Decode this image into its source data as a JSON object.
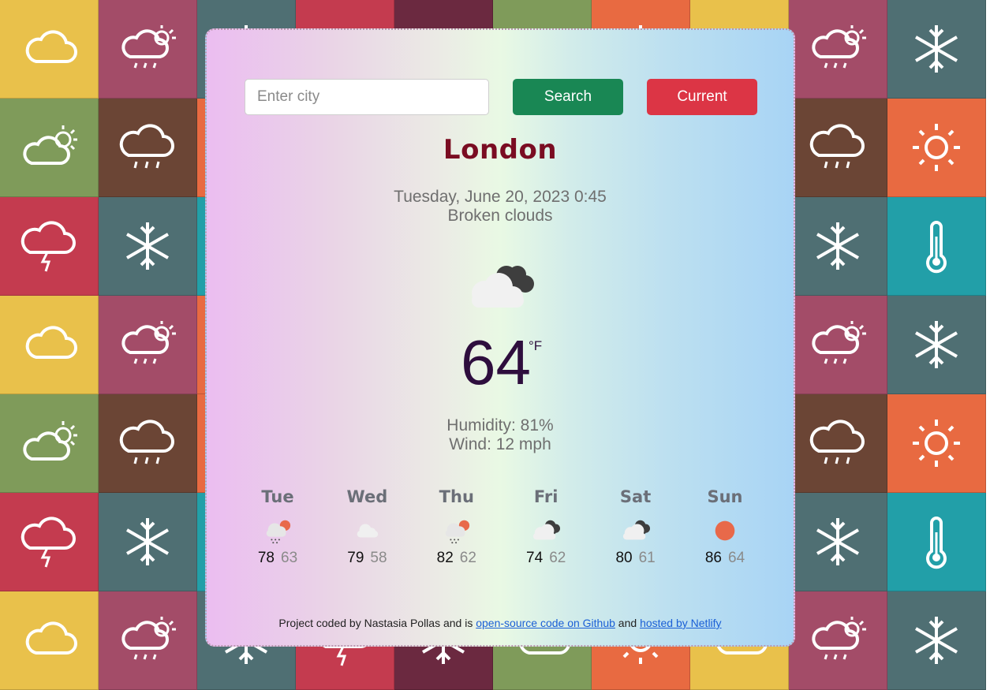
{
  "search": {
    "placeholder": "Enter city",
    "search_label": "Search",
    "current_label": "Current"
  },
  "weather": {
    "city": "London",
    "date": "Tuesday, June 20, 2023 0:45",
    "description": "Broken clouds",
    "icon": "broken-clouds-icon",
    "temperature": "64",
    "unit": "°F",
    "humidity": "Humidity: 81%",
    "wind": "Wind: 12 mph"
  },
  "forecast": [
    {
      "day": "Tue",
      "icon": "rain-icon",
      "max": "78",
      "min": "63"
    },
    {
      "day": "Wed",
      "icon": "few-clouds-icon",
      "max": "79",
      "min": "58"
    },
    {
      "day": "Thu",
      "icon": "rain-icon",
      "max": "82",
      "min": "62"
    },
    {
      "day": "Fri",
      "icon": "broken-clouds-icon",
      "max": "74",
      "min": "62"
    },
    {
      "day": "Sat",
      "icon": "broken-clouds-icon",
      "max": "80",
      "min": "61"
    },
    {
      "day": "Sun",
      "icon": "clear-sky-icon",
      "max": "86",
      "min": "64"
    }
  ],
  "footer": {
    "text_before": "Project coded by Nastasia Pollas and is ",
    "github_link": "open-source code on Github",
    "text_middle": " and ",
    "netlify_link": "hosted by Netlify"
  },
  "colors": {
    "search_button": "#198754",
    "current_button": "#dc3545",
    "city": "#7a0d22",
    "temperature": "#2e0e3d"
  },
  "background_tile_icons": [
    "cloud-icon",
    "cloud-sun-rain-icon",
    "cloud-sun-icon",
    "cloud-rain-icon",
    "thunderstorm-icon",
    "snowflake-icon",
    "sun-icon",
    "thermometer-icon"
  ]
}
